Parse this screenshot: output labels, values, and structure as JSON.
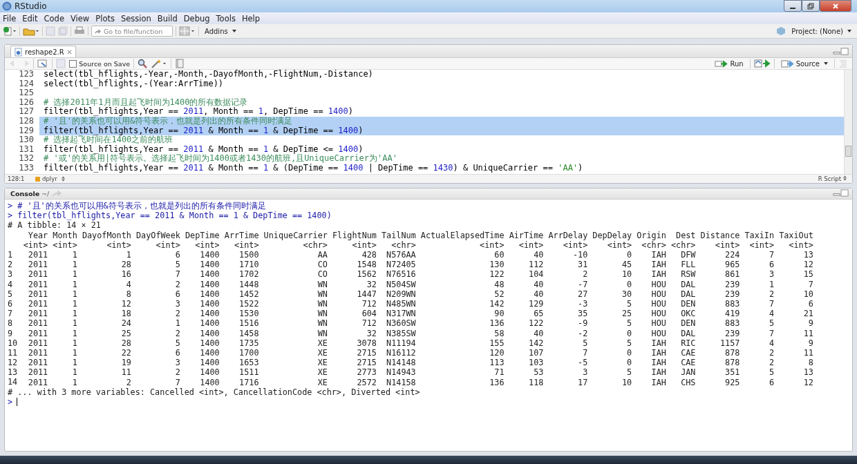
{
  "window": {
    "title": "RStudio"
  },
  "menu": [
    "File",
    "Edit",
    "Code",
    "View",
    "Plots",
    "Session",
    "Build",
    "Debug",
    "Tools",
    "Help"
  ],
  "toolbar": {
    "goto_placeholder": "Go to file/function",
    "addins": "Addins",
    "project": "Project: (None)"
  },
  "editor": {
    "tabs": [
      {
        "label": "reshape2.R",
        "selected": true
      }
    ],
    "source_on_save": {
      "label": "Source on Save",
      "checked": false
    },
    "run": "Run",
    "source": "Source",
    "lines": [
      {
        "num": "123",
        "selected": false,
        "tokens": [
          {
            "kind": "text",
            "text": "select(tbl_hflights,-Year,-Month,-DayofMonth,-FlightNum,-Distance)"
          }
        ]
      },
      {
        "num": "124",
        "selected": false,
        "tokens": [
          {
            "kind": "text",
            "text": "select(tbl_hflights,-(Year:ArrTime))"
          }
        ]
      },
      {
        "num": "125",
        "selected": false
      },
      {
        "num": "126",
        "selected": false,
        "tokens": [
          {
            "kind": "comment",
            "text": "# 选择2011年1月而且起飞时间为1400的所有数据记录"
          }
        ]
      },
      {
        "num": "127",
        "selected": false,
        "tokens": [
          {
            "kind": "text",
            "text": "filter(tbl_hflights,Year == "
          },
          {
            "kind": "number",
            "text": "2011"
          },
          {
            "kind": "text",
            "text": ", Month == "
          },
          {
            "kind": "number",
            "text": "1"
          },
          {
            "kind": "text",
            "text": ", DepTime == "
          },
          {
            "kind": "number",
            "text": "1400"
          },
          {
            "kind": "text",
            "text": ")"
          }
        ]
      },
      {
        "num": "128",
        "selected": true,
        "tokens": [
          {
            "kind": "comment",
            "text": "# '且'的关系也可以用&符号表示，也就是列出的所有条件同时满足"
          }
        ]
      },
      {
        "num": "129",
        "selected": true,
        "tokens": [
          {
            "kind": "text",
            "text": "filter(tbl_hflights,Year == "
          },
          {
            "kind": "number",
            "text": "2011"
          },
          {
            "kind": "text",
            "text": " & Month == "
          },
          {
            "kind": "number",
            "text": "1"
          },
          {
            "kind": "text",
            "text": " & DepTime == "
          },
          {
            "kind": "number",
            "text": "1400"
          },
          {
            "kind": "text",
            "text": ")"
          }
        ]
      },
      {
        "num": "130",
        "selected": false,
        "tokens": [
          {
            "kind": "comment",
            "text": "# 选择起飞时间在1400之前的航班"
          }
        ]
      },
      {
        "num": "131",
        "selected": false,
        "tokens": [
          {
            "kind": "text",
            "text": "filter(tbl_hflights,Year == "
          },
          {
            "kind": "number",
            "text": "2011"
          },
          {
            "kind": "text",
            "text": " & Month == "
          },
          {
            "kind": "number",
            "text": "1"
          },
          {
            "kind": "text",
            "text": " & DepTime <= "
          },
          {
            "kind": "number",
            "text": "1400"
          },
          {
            "kind": "text",
            "text": ")"
          }
        ]
      },
      {
        "num": "132",
        "selected": false,
        "tokens": [
          {
            "kind": "comment",
            "text": "# '或'的关系用|符号表示。选择起飞时间为1400或者1430的航班,且UniqueCarrier为'AA'"
          }
        ]
      },
      {
        "num": "133",
        "selected": false,
        "tokens": [
          {
            "kind": "text",
            "text": "filter(tbl_hflights,Year == "
          },
          {
            "kind": "number",
            "text": "2011"
          },
          {
            "kind": "text",
            "text": " & Month == "
          },
          {
            "kind": "number",
            "text": "1"
          },
          {
            "kind": "text",
            "text": " & (DepTime == "
          },
          {
            "kind": "number",
            "text": "1400"
          },
          {
            "kind": "text",
            "text": " | DepTime == "
          },
          {
            "kind": "number",
            "text": "1430"
          },
          {
            "kind": "text",
            "text": ") & UniqueCarrier == "
          },
          {
            "kind": "string",
            "text": "'AA'"
          },
          {
            "kind": "text",
            "text": ")"
          }
        ]
      }
    ],
    "status": {
      "position": "128:1",
      "scope": "dplyr",
      "file_type": "R Script"
    }
  },
  "console": {
    "title": "Console",
    "path": "~/",
    "echo": [
      {
        "prompt": ">",
        "text": "# '且'的关系也可以用&符号表示，也就是列出的所有条件同时满足"
      },
      {
        "prompt": ">",
        "text": "filter(tbl_hflights,Year == 2011 & Month == 1 & DepTime == 1400)"
      }
    ],
    "tibble_header": "# A tibble: 14 × 21",
    "columns": [
      {
        "name": "Year",
        "type": "<int>"
      },
      {
        "name": "Month",
        "type": "<int>"
      },
      {
        "name": "DayofMonth",
        "type": "<int>"
      },
      {
        "name": "DayOfWeek",
        "type": "<int>"
      },
      {
        "name": "DepTime",
        "type": "<int>"
      },
      {
        "name": "ArrTime",
        "type": "<int>"
      },
      {
        "name": "UniqueCarrier",
        "type": "<chr>"
      },
      {
        "name": "FlightNum",
        "type": "<int>"
      },
      {
        "name": "TailNum",
        "type": "<chr>"
      },
      {
        "name": "ActualElapsedTime",
        "type": "<int>"
      },
      {
        "name": "AirTime",
        "type": "<int>"
      },
      {
        "name": "ArrDelay",
        "type": "<int>"
      },
      {
        "name": "DepDelay",
        "type": "<int>"
      },
      {
        "name": "Origin",
        "type": "<chr>"
      },
      {
        "name": "Dest",
        "type": "<chr>"
      },
      {
        "name": "Distance",
        "type": "<int>"
      },
      {
        "name": "TaxiIn",
        "type": "<int>"
      },
      {
        "name": "TaxiOut",
        "type": "<int>"
      }
    ],
    "rows": [
      {
        "index": "1",
        "cells": [
          "2011",
          "1",
          "1",
          "6",
          "1400",
          "1500",
          "AA",
          "428",
          "N576AA",
          "60",
          "40",
          "-10",
          "0",
          "IAH",
          "DFW",
          "224",
          "7",
          "13"
        ]
      },
      {
        "index": "2",
        "cells": [
          "2011",
          "1",
          "28",
          "5",
          "1400",
          "1710",
          "CO",
          "1548",
          "N72405",
          "130",
          "112",
          "31",
          "45",
          "IAH",
          "FLL",
          "965",
          "6",
          "12"
        ]
      },
      {
        "index": "3",
        "cells": [
          "2011",
          "1",
          "16",
          "7",
          "1400",
          "1702",
          "CO",
          "1562",
          "N76516",
          "122",
          "104",
          "2",
          "10",
          "IAH",
          "RSW",
          "861",
          "3",
          "15"
        ]
      },
      {
        "index": "4",
        "cells": [
          "2011",
          "1",
          "4",
          "2",
          "1400",
          "1448",
          "WN",
          "32",
          "N504SW",
          "48",
          "40",
          "-7",
          "0",
          "HOU",
          "DAL",
          "239",
          "1",
          "7"
        ]
      },
      {
        "index": "5",
        "cells": [
          "2011",
          "1",
          "8",
          "6",
          "1400",
          "1452",
          "WN",
          "1447",
          "N209WN",
          "52",
          "40",
          "27",
          "30",
          "HOU",
          "DAL",
          "239",
          "2",
          "10"
        ]
      },
      {
        "index": "6",
        "cells": [
          "2011",
          "1",
          "12",
          "3",
          "1400",
          "1522",
          "WN",
          "712",
          "N485WN",
          "142",
          "129",
          "-3",
          "5",
          "HOU",
          "DEN",
          "883",
          "7",
          "6"
        ]
      },
      {
        "index": "7",
        "cells": [
          "2011",
          "1",
          "18",
          "2",
          "1400",
          "1530",
          "WN",
          "604",
          "N317WN",
          "90",
          "65",
          "35",
          "25",
          "HOU",
          "OKC",
          "419",
          "4",
          "21"
        ]
      },
      {
        "index": "8",
        "cells": [
          "2011",
          "1",
          "24",
          "1",
          "1400",
          "1516",
          "WN",
          "712",
          "N360SW",
          "136",
          "122",
          "-9",
          "5",
          "HOU",
          "DEN",
          "883",
          "5",
          "9"
        ]
      },
      {
        "index": "9",
        "cells": [
          "2011",
          "1",
          "25",
          "2",
          "1400",
          "1458",
          "WN",
          "32",
          "N385SW",
          "58",
          "40",
          "-2",
          "0",
          "HOU",
          "DAL",
          "239",
          "7",
          "11"
        ]
      },
      {
        "index": "10",
        "cells": [
          "2011",
          "1",
          "28",
          "5",
          "1400",
          "1735",
          "XE",
          "3078",
          "N11194",
          "155",
          "142",
          "5",
          "5",
          "IAH",
          "RIC",
          "1157",
          "4",
          "9"
        ]
      },
      {
        "index": "11",
        "cells": [
          "2011",
          "1",
          "22",
          "6",
          "1400",
          "1700",
          "XE",
          "2715",
          "N16112",
          "120",
          "107",
          "7",
          "0",
          "IAH",
          "CAE",
          "878",
          "2",
          "11"
        ]
      },
      {
        "index": "12",
        "cells": [
          "2011",
          "1",
          "19",
          "3",
          "1400",
          "1653",
          "XE",
          "2715",
          "N14148",
          "113",
          "103",
          "-5",
          "0",
          "IAH",
          "CAE",
          "878",
          "2",
          "8"
        ]
      },
      {
        "index": "13",
        "cells": [
          "2011",
          "1",
          "11",
          "2",
          "1400",
          "1511",
          "XE",
          "2773",
          "N14943",
          "71",
          "53",
          "3",
          "5",
          "IAH",
          "JAN",
          "351",
          "5",
          "13"
        ]
      },
      {
        "index": "14",
        "cells": [
          "2011",
          "1",
          "2",
          "7",
          "1400",
          "1716",
          "XE",
          "2572",
          "N14158",
          "136",
          "118",
          "17",
          "10",
          "IAH",
          "CHS",
          "925",
          "6",
          "12"
        ]
      }
    ],
    "footer": "# ... with 3 more variables: Cancelled <int>, CancellationCode <chr>, Diverted <int>",
    "prompt": ">"
  }
}
